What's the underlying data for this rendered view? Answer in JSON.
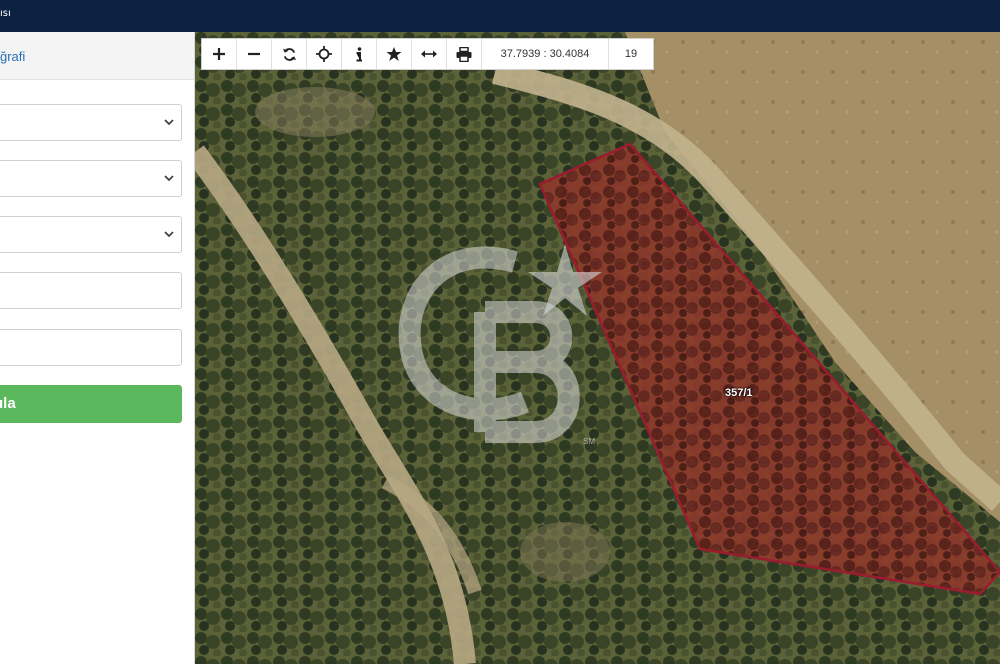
{
  "topbar": {
    "text": "ısı"
  },
  "sidebar": {
    "header_label": "ğrafi",
    "fields": [
      {
        "type": "select",
        "value": ""
      },
      {
        "type": "select",
        "value": ""
      },
      {
        "type": "select",
        "value": ""
      },
      {
        "type": "input",
        "value": ""
      },
      {
        "type": "input",
        "value": ""
      }
    ],
    "submit_label": "ula"
  },
  "map": {
    "toolbar": {
      "buttons": [
        "zoom-in-icon",
        "zoom-out-icon",
        "refresh-icon",
        "locate-icon",
        "info-icon",
        "star-icon",
        "measure-icon",
        "print-icon"
      ],
      "coordinates": "37.7939 : 30.4084",
      "zoom_level": "19"
    },
    "parcel_label": "357/1",
    "watermark_sub": "SM",
    "colors": {
      "parcel_outline": "#9b1c2e",
      "parcel_fill": "#b5342a",
      "topbar": "#0d2240",
      "submit": "#5cb85c"
    }
  }
}
